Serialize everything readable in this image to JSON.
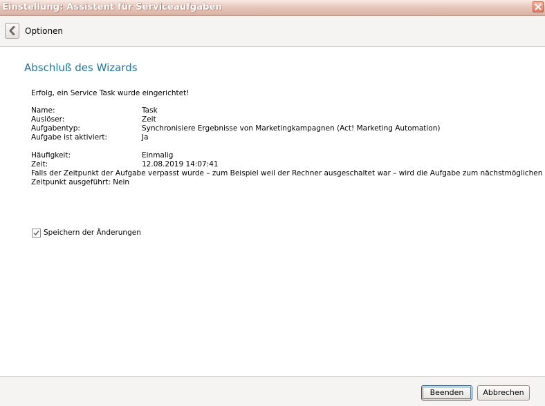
{
  "window": {
    "title": "Einstellung: Assistent für Serviceaufgaben"
  },
  "nav": {
    "label": "Optionen"
  },
  "main": {
    "heading": "Abschluß des Wizards",
    "success_message": "Erfolg, ein Service Task wurde eingerichtet!",
    "details": [
      {
        "label": "Name:",
        "value": "Task"
      },
      {
        "label": "Auslöser:",
        "value": "Zeit"
      },
      {
        "label": "Aufgabentyp:",
        "value": "Synchronisiere Ergebnisse von Marketingkampagnen (Act! Marketing Automation)"
      },
      {
        "label": "Aufgabe ist aktiviert:",
        "value": "Ja"
      }
    ],
    "schedule": [
      {
        "label": "Häufigkeit:",
        "value": "Einmalig"
      },
      {
        "label": "Zeit:",
        "value": "12.08.2019 14:07:41"
      }
    ],
    "missed_note_line1": "Falls der Zeitpunkt der Aufgabe verpasst wurde – zum Beispiel weil der Rechner ausgeschaltet war – wird die Aufgabe zum nächstmöglichen",
    "missed_note_line2": "Zeitpunkt ausgeführt: Nein",
    "save_changes": {
      "label": "Speichern der Änderungen",
      "checked": true
    }
  },
  "footer": {
    "finish_label": "Beenden",
    "cancel_label": "Abbrechen"
  },
  "colors": {
    "heading": "#1f73a6",
    "titlebar": "#e7c9bd",
    "close_button": "#e07a63"
  }
}
